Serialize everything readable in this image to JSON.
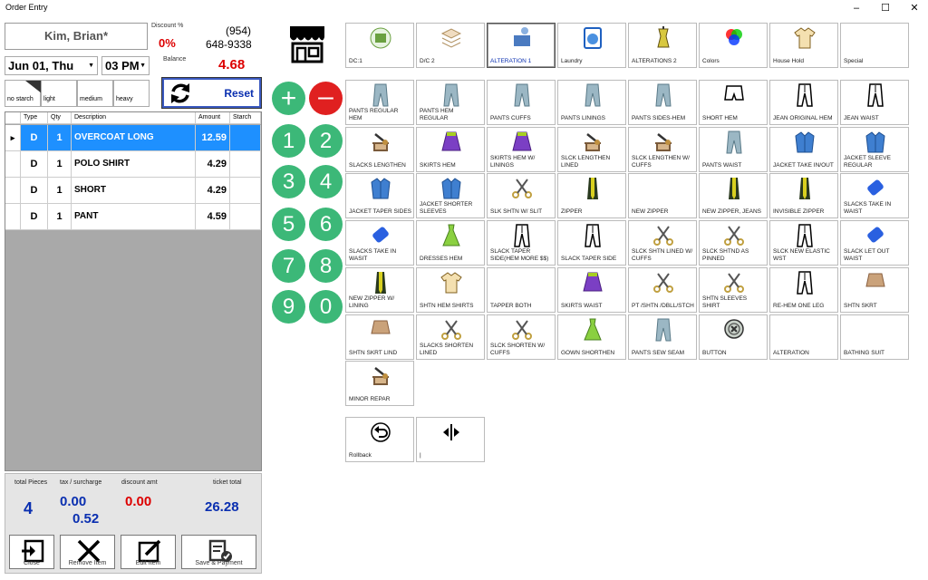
{
  "window": {
    "title": "Order Entry",
    "min": "–",
    "max": "☐",
    "close": "✕"
  },
  "customer": {
    "name": "Kim, Brian*",
    "phone_area": "(954)",
    "phone": "648-9338"
  },
  "discount": {
    "label": "Discount %",
    "value": "0%"
  },
  "balance": {
    "label": "Balance",
    "value": "4.68"
  },
  "date": {
    "value": "Jun 01, Thu"
  },
  "time": {
    "value": "03 PM"
  },
  "starch": {
    "options": [
      "no starch",
      "light",
      "medium",
      "heavy"
    ]
  },
  "reset": {
    "label": "Reset"
  },
  "grid": {
    "headers": [
      "Type",
      "Qty",
      "Description",
      "Amount",
      "Starch"
    ],
    "rows": [
      {
        "type": "D",
        "qty": "1",
        "desc": "OVERCOAT LONG",
        "amount": "12.59",
        "starch": ""
      },
      {
        "type": "D",
        "qty": "1",
        "desc": "POLO SHIRT",
        "amount": "4.29",
        "starch": ""
      },
      {
        "type": "D",
        "qty": "1",
        "desc": "SHORT",
        "amount": "4.29",
        "starch": ""
      },
      {
        "type": "D",
        "qty": "1",
        "desc": "PANT",
        "amount": "4.59",
        "starch": ""
      }
    ]
  },
  "totals": {
    "pieces_label": "total Pieces",
    "pieces": "4",
    "tax_label": "tax / surcharge",
    "tax": "0.00",
    "surcharge": "0.52",
    "discount_label": "discount amt",
    "discount": "0.00",
    "ticket_label": "ticket total",
    "ticket": "26.28"
  },
  "bottom_buttons": [
    "Close",
    "Remove Item",
    "Edit Item",
    "Save & Payment"
  ],
  "keypad": {
    "plus": "+",
    "minus": "–",
    "digits": [
      "1",
      "2",
      "3",
      "4",
      "5",
      "6",
      "7",
      "8",
      "9",
      "0"
    ]
  },
  "categories": [
    {
      "label": "DC:1",
      "icon": "folded-clothes-icon"
    },
    {
      "label": "D/C 2",
      "icon": "folded-towels-icon"
    },
    {
      "label": "ALTERATION 1",
      "icon": "sewing-figure-icon",
      "active": true
    },
    {
      "label": "Laundry",
      "icon": "washing-machine-icon"
    },
    {
      "label": "ALTERATIONS 2",
      "icon": "mannequin-icon"
    },
    {
      "label": "Colors",
      "icon": "color-circles-icon"
    },
    {
      "label": "House Hold",
      "icon": "shirt-icon"
    },
    {
      "label": "Special",
      "icon": ""
    }
  ],
  "items": [
    {
      "label": "PANTS REGULAR HEM",
      "icon": "pants-icon"
    },
    {
      "label": "PANTS HEM REGULAR",
      "icon": "pants-icon"
    },
    {
      "label": "PANTS CUFFS",
      "icon": "pants-icon"
    },
    {
      "label": "PANTS LININGS",
      "icon": "pants-icon"
    },
    {
      "label": "PANTS SIDES-HEM",
      "icon": "pants-icon"
    },
    {
      "label": "SHORT HEM",
      "icon": "shorts-icon"
    },
    {
      "label": "JEAN ORIGINAL HEM",
      "icon": "jeans-icon"
    },
    {
      "label": "JEAN WAIST",
      "icon": "jeans-icon"
    },
    {
      "label": "SLACKS LENGTHEN",
      "icon": "sewing-machine-icon"
    },
    {
      "label": "SKIRTS HEM",
      "icon": "skirt-icon"
    },
    {
      "label": "SKIRTS HEM W/ LININGS",
      "icon": "skirt-icon"
    },
    {
      "label": "SLCK LENGTHEN LINED",
      "icon": "sewing-machine-icon"
    },
    {
      "label": "SLCK LENGTHEN W/ CUFFS",
      "icon": "sewing-machine-icon"
    },
    {
      "label": "PANTS WAIST",
      "icon": "pants-icon"
    },
    {
      "label": "JACKET TAKE IN/OUT",
      "icon": "jacket-icon"
    },
    {
      "label": "JACKET SLEEVE REGULAR",
      "icon": "jacket-icon"
    },
    {
      "label": "JACKET TAPER SIDES",
      "icon": "jacket-icon"
    },
    {
      "label": "JACKET SHORTER SLEEVES",
      "icon": "jacket-icon"
    },
    {
      "label": "SLK SHTN W/ SLIT",
      "icon": "scissors-icon"
    },
    {
      "label": "ZIPPER",
      "icon": "zipper-icon"
    },
    {
      "label": "NEW ZIPPER",
      "icon": ""
    },
    {
      "label": "NEW ZIPPER, JEANS",
      "icon": "zipper-icon"
    },
    {
      "label": "INVISIBLE ZIPPER",
      "icon": "zipper-icon"
    },
    {
      "label": "SLACKS TAKE IN WAIST",
      "icon": "thread-spool-icon"
    },
    {
      "label": "SLACKS TAKE IN WASIT",
      "icon": "thread-spool-icon"
    },
    {
      "label": "DRESSES HEM",
      "icon": "dress-icon"
    },
    {
      "label": "SLACK TAPER SIDE(HEM MORE $$)",
      "icon": "jeans-icon"
    },
    {
      "label": "SLACK TAPER SIDE",
      "icon": "jeans-icon"
    },
    {
      "label": "SLCK SHTN LINED W/ CUFFS",
      "icon": "scissors-icon"
    },
    {
      "label": "SLCK SHTND AS PINNED",
      "icon": "scissors-icon"
    },
    {
      "label": "SLCK NEW ELASTIC WST",
      "icon": "jeans-icon"
    },
    {
      "label": "SLACK LET OUT WAIST",
      "icon": "thread-spool-icon"
    },
    {
      "label": "NEW ZIPPER W/ LINING",
      "icon": "zipper-icon"
    },
    {
      "label": "SHTN HEM SHIRTS",
      "icon": "shirt-icon"
    },
    {
      "label": "TAPPER BOTH",
      "icon": ""
    },
    {
      "label": "SKIRTS WAIST",
      "icon": "skirt-icon"
    },
    {
      "label": "PT /SHTN /DBLL/STCH",
      "icon": "scissors-icon"
    },
    {
      "label": "SHTN SLEEVES SHIRT",
      "icon": "scissors-icon"
    },
    {
      "label": "RE-HEM ONE LEG",
      "icon": "jeans-icon"
    },
    {
      "label": "SHTN SKRT",
      "icon": "short-skirt-icon"
    },
    {
      "label": "SHTN SKRT LIND",
      "icon": "short-skirt-icon"
    },
    {
      "label": "SLACKS SHORTEN LINED",
      "icon": "scissors-icon"
    },
    {
      "label": "SLCK SHORTEN W/ CUFFS",
      "icon": "scissors-icon"
    },
    {
      "label": "GOWN SHORTHEN",
      "icon": "dress-icon"
    },
    {
      "label": "PANTS SEW SEAM",
      "icon": "pants-icon"
    },
    {
      "label": "BUTTON",
      "icon": "button-icon"
    },
    {
      "label": "ALTERATION",
      "icon": ""
    },
    {
      "label": "BATHING SUIT",
      "icon": ""
    },
    {
      "label": "MINOR REPAR",
      "icon": "sewing-machine-icon"
    }
  ],
  "nav": [
    {
      "label": "Rollback",
      "icon": "undo-icon"
    },
    {
      "label": "|",
      "icon": "split-icon"
    }
  ],
  "colors": {
    "accent": "#0a2fb0",
    "red": "#dd0000",
    "green": "#3cb878",
    "selected_row": "#1e90ff"
  }
}
